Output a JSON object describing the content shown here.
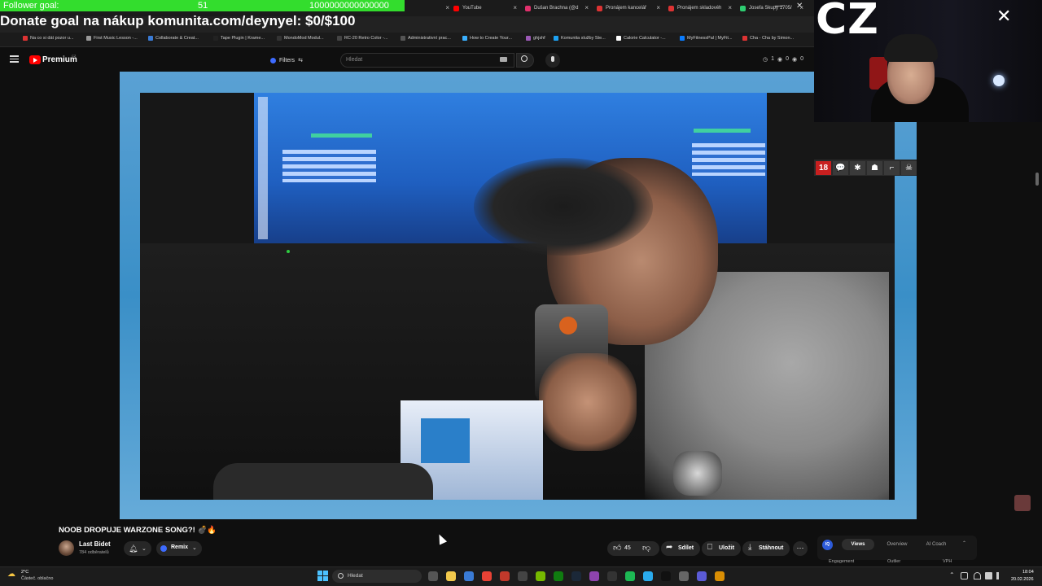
{
  "overlay": {
    "follower_label": "Follower goal:",
    "follower_current": "51",
    "follower_target": "1000000000000000",
    "donate_text": "Donate goal na nákup komunita.com/deynyel: $0/$100",
    "cz_text": "CZ",
    "badge_18": "18"
  },
  "browser": {
    "tabs": [
      {
        "label": "ube",
        "color": "#ff0000"
      },
      {
        "label": "YouTube",
        "color": "#ff0000"
      },
      {
        "label": "Dušan Brachna (@d",
        "color": "#e1306c"
      },
      {
        "label": "Pronájem kancelář",
        "color": "#d33"
      },
      {
        "label": "Pronájem skladovéh",
        "color": "#d33"
      },
      {
        "label": "Josefa Skupy 1705/",
        "color": "#2ecc71"
      }
    ],
    "bookmarks": [
      {
        "label": "Na co si dát pozor u...",
        "color": "#d33"
      },
      {
        "label": "First Music Lesson -...",
        "color": "#999"
      },
      {
        "label": "Collaborate & Creat...",
        "color": "#3a7bd5"
      },
      {
        "label": "Tape Plugin | Krame...",
        "color": "#222"
      },
      {
        "label": "MondoMod Modul...",
        "color": "#333"
      },
      {
        "label": "RC-20 Retro Color -...",
        "color": "#444"
      },
      {
        "label": "Administrativní prac...",
        "color": "#555"
      },
      {
        "label": "How to Create Your...",
        "color": "#3ab0ff"
      },
      {
        "label": "ghjshf",
        "color": "#9b59b6"
      },
      {
        "label": "Komunita služby Ste...",
        "color": "#1da1f2"
      },
      {
        "label": "Calorie Calculator -...",
        "color": "#fff"
      },
      {
        "label": "MyFitnessPal | MyFit...",
        "color": "#0a7cff"
      },
      {
        "label": "Cha - Cha by Simon...",
        "color": "#d33"
      }
    ],
    "minimize": "—",
    "close": "✕"
  },
  "youtube": {
    "brand": "Premium",
    "country": "CZ",
    "filters_label": "Filters",
    "search_placeholder": "Hledat",
    "stats": [
      "1",
      "0",
      "0"
    ],
    "video": {
      "title": "NOOB DROPUJE WARZONE SONG?! 💣🔥",
      "channel": "Last Bidet",
      "subscribers": "784 odběratelů",
      "remix_label": "Remix",
      "likes": "45",
      "share_label": "Sdílet",
      "save_label": "Uložit",
      "download_label": "Stáhnout",
      "more": "⋯"
    }
  },
  "analytics": {
    "logo": "IQ",
    "tabs": [
      "Views",
      "Overview",
      "AI Coach"
    ],
    "columns": [
      "Engagement",
      "Outlier",
      "VPH"
    ]
  },
  "taskbar": {
    "temperature": "2°C",
    "weather": "Částeč. oblačno",
    "search_placeholder": "Hledat",
    "time": "18:04",
    "date": "20.02.2026",
    "apps": [
      {
        "name": "task-view",
        "color": "#555"
      },
      {
        "name": "file-explorer",
        "color": "#f2c94c"
      },
      {
        "name": "mail",
        "color": "#3a7bd5"
      },
      {
        "name": "chrome",
        "color": "#e94235"
      },
      {
        "name": "app-red",
        "color": "#c0392b"
      },
      {
        "name": "app-dark",
        "color": "#444"
      },
      {
        "name": "nvidia",
        "color": "#76b900"
      },
      {
        "name": "xbox",
        "color": "#107c10"
      },
      {
        "name": "steam",
        "color": "#1b2838"
      },
      {
        "name": "app-purple",
        "color": "#8e44ad"
      },
      {
        "name": "app-dark2",
        "color": "#333"
      },
      {
        "name": "spotify",
        "color": "#1db954"
      },
      {
        "name": "telegram",
        "color": "#2aabee"
      },
      {
        "name": "app-black",
        "color": "#111"
      },
      {
        "name": "app-gear",
        "color": "#666"
      },
      {
        "name": "app-grid",
        "color": "#5b5bd6"
      },
      {
        "name": "app-shield",
        "color": "#d98e04"
      }
    ]
  }
}
